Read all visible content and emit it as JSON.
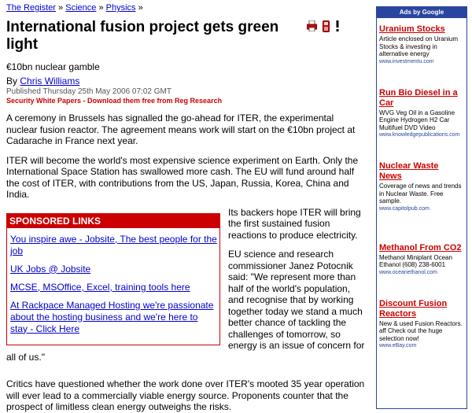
{
  "breadcrumb": {
    "items": [
      "The Register",
      "Science",
      "Physics"
    ],
    "separator": "»"
  },
  "article": {
    "title": "International fusion project gets green light",
    "standfirst": "€10bn nuclear gamble",
    "byline_prefix": "By",
    "author": "Chris Williams",
    "published": "Published Thursday 25th May 2006 07:02 GMT",
    "security_link": "Security White Papers - Download them free from Reg Research",
    "paragraphs": [
      "A ceremony in Brussels has signalled the go-ahead for ITER, the experimental nuclear fusion reactor. The agreement means work will start on the €10bn project at Cadarache in France next year.",
      "ITER will become the world's most expensive science experiment on Earth. Only the International Space Station has swallowed more cash. The EU will fund around half the cost of ITER, with contributions from the US, Japan, Russia, Korea, China and India.",
      "Its backers hope ITER will bring the first sustained fusion reactions to produce electricity.",
      "EU science and research commissioner Janez Potocnik said: \"We represent more than half of the world's population, and recognise that by working together today we stand a much better chance of tackling the challenges of tomorrow, so energy is an issue of concern for all of us.\"",
      "Critics have questioned whether the work done over ITER's mooted 35 year operation will ever lead to a commercially viable energy source. Proponents counter that the prospect of limitless clean energy outweighs the risks."
    ],
    "tools": [
      "print-icon",
      "mobile-icon",
      "alert-icon"
    ]
  },
  "sponsored": {
    "header": "SPONSORED LINKS",
    "links": [
      "You inspire awe - Jobsite, The best people for the job",
      "UK Jobs @ Jobsite",
      "MCSE, MSOffice, Excel, training tools here",
      "At Rackpace Managed Hosting we're passionate about the hosting business and we're here to stay - Click Here"
    ]
  },
  "ads": {
    "header": "Ads by Google",
    "items": [
      {
        "title": "Uranium Stocks",
        "desc": "Article enclosed on Uranium Stocks & investing in alternative energy",
        "url": "www.investmentu.com"
      },
      {
        "title": "Run Bio Diesel in a Car",
        "desc": "WVG Veg Oil in a Gasoline Engine Hydrogen H2 Car Multifuel DVD Video",
        "url": "www.knowledgepublications.com"
      },
      {
        "title": "Nuclear Waste News",
        "desc": "Coverage of news and trends in Nuclear Waste. Free sample.",
        "url": "www.capitolpub.com"
      },
      {
        "title": "Methanol From CO2",
        "desc": "Methanol Miniplant Ocean Ethanol (608) 238-6001",
        "url": "www.oceanethanol.com"
      },
      {
        "title": "Discount Fusion Reactors",
        "desc": "New & used Fusion Reactors. aff Check out the huge selection now!",
        "url": "www.eBay.com"
      }
    ]
  },
  "colors": {
    "link": "#0000cc",
    "accent_red": "#cc0000",
    "ads_blue": "#2a45a0"
  }
}
